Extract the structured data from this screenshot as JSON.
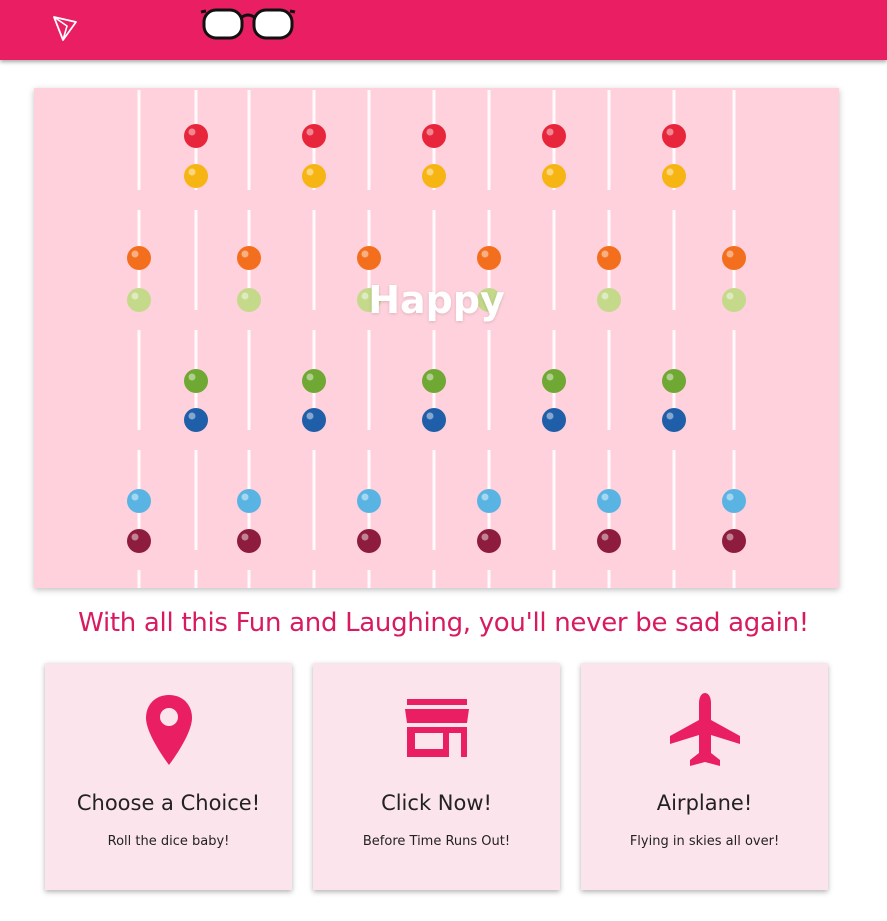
{
  "colors": {
    "brand": "#e91e63",
    "accent_text": "#d81b60",
    "hero_bg": "#ffd1dc",
    "card_bg": "#fce4ec"
  },
  "header": {
    "logo_icon": "paper-plane-icon",
    "center_icon": "glasses-icon"
  },
  "hero": {
    "title": "Happy",
    "image": "lollipops-pattern"
  },
  "tagline": "With all this Fun and Laughing, you'll never be sad again!",
  "cards": [
    {
      "icon": "map-marker-icon",
      "title": "Choose a Choice!",
      "subtitle": "Roll the dice baby!"
    },
    {
      "icon": "storefront-icon",
      "title": "Click Now!",
      "subtitle": "Before Time Runs Out!"
    },
    {
      "icon": "airplane-icon",
      "title": "Airplane!",
      "subtitle": "Flying in skies all over!"
    }
  ]
}
